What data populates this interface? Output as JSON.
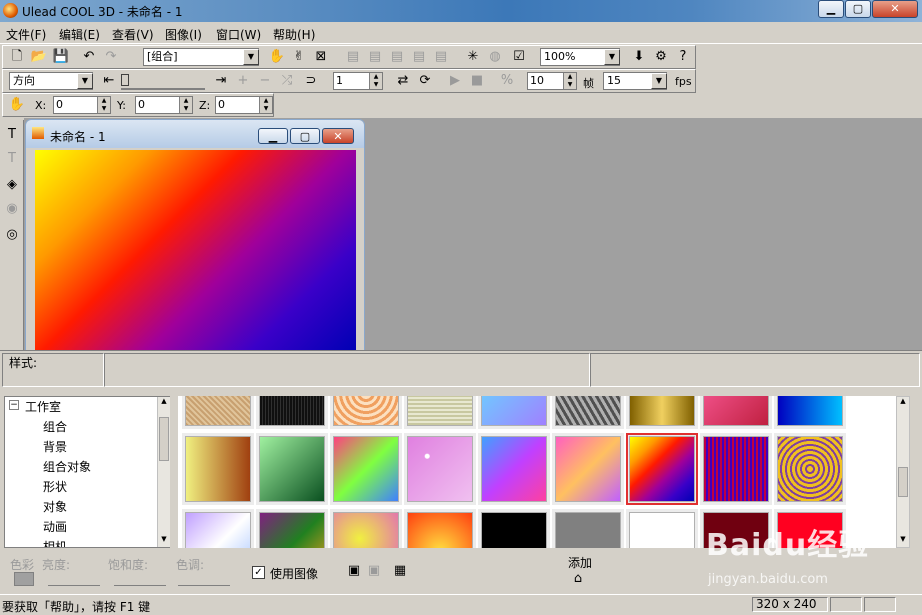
{
  "window": {
    "title": "Ulead COOL 3D - 未命名 - 1"
  },
  "menu": [
    "文件(F)",
    "编辑(E)",
    "查看(V)",
    "图像(I)",
    "窗口(W)",
    "帮助(H)"
  ],
  "toolbar1": {
    "group_combo": "[组合]",
    "zoom_combo": "100%"
  },
  "toolbar2": {
    "direction_combo": "方向",
    "frame_value": "1",
    "frames_value": "10",
    "frames_label": "帧",
    "fps_value": "15",
    "fps_label": "fps"
  },
  "toolbar3": {
    "x_label": "X:",
    "x_value": "0",
    "y_label": "Y:",
    "y_value": "0",
    "z_label": "Z:",
    "z_value": "0"
  },
  "document": {
    "title": "未命名 - 1"
  },
  "style_bar": {
    "label": "样式:"
  },
  "tree": {
    "root": "工作室",
    "items": [
      "组合",
      "背景",
      "组合对象",
      "形状",
      "对象",
      "动画",
      "相机"
    ]
  },
  "bottom": {
    "color_label": "色彩",
    "brightness_label": "亮度:",
    "saturation_label": "饱和度:",
    "hue_label": "色调:",
    "use_image_label": "使用图像",
    "add_label": "添加"
  },
  "status": {
    "help_text": "要获取「帮助」，请按 F1 键",
    "size": "320 x 240"
  },
  "watermark": {
    "main": "Baidu经验",
    "sub": "jingyan.baidu.com"
  },
  "colors": {
    "selection": "#e03030",
    "titlebar": "#3c78b8"
  }
}
